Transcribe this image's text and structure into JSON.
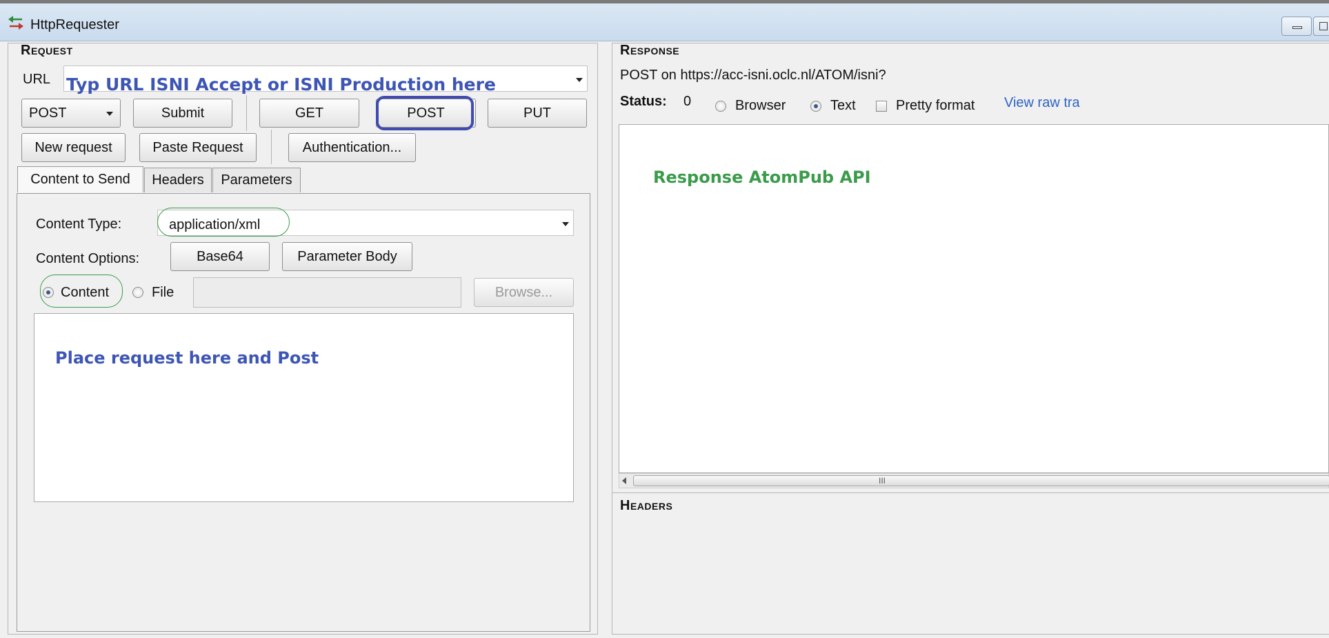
{
  "window": {
    "title": "HttpRequester",
    "app_icon": "http-requester-arrows-icon"
  },
  "request": {
    "section_title": "Request",
    "url_label": "URL",
    "url_annotation": "Typ URL ISNI Accept or ISNI Production here",
    "method_select_value": "POST",
    "buttons": {
      "submit": "Submit",
      "get": "GET",
      "post": "POST",
      "put": "PUT",
      "new_request": "New request",
      "paste_request": "Paste Request",
      "authentication": "Authentication..."
    },
    "tabs": [
      "Content to Send",
      "Headers",
      "Parameters"
    ],
    "content": {
      "content_type_label": "Content Type:",
      "content_type_value": "application/xml",
      "content_options_label": "Content Options:",
      "base64_button": "Base64",
      "parameter_body_button": "Parameter Body",
      "radio_content": "Content",
      "radio_file": "File",
      "browse_button": "Browse...",
      "body_annotation": "Place request here and Post"
    }
  },
  "response": {
    "section_title": "Response",
    "summary": "POST on https://acc-isni.oclc.nl/ATOM/isni?",
    "status_label": "Status:",
    "status_value": "0",
    "radio_browser": "Browser",
    "radio_text": "Text",
    "pretty_format": "Pretty format",
    "view_raw_link": "View raw tra",
    "body_annotation": "Response AtomPub API",
    "scrollbar_grip": "III",
    "headers_title": "Headers"
  },
  "colors": {
    "annotation_blue": "#3d55b5",
    "annotation_green": "#3a9b4a",
    "link_blue": "#2f63c4"
  }
}
